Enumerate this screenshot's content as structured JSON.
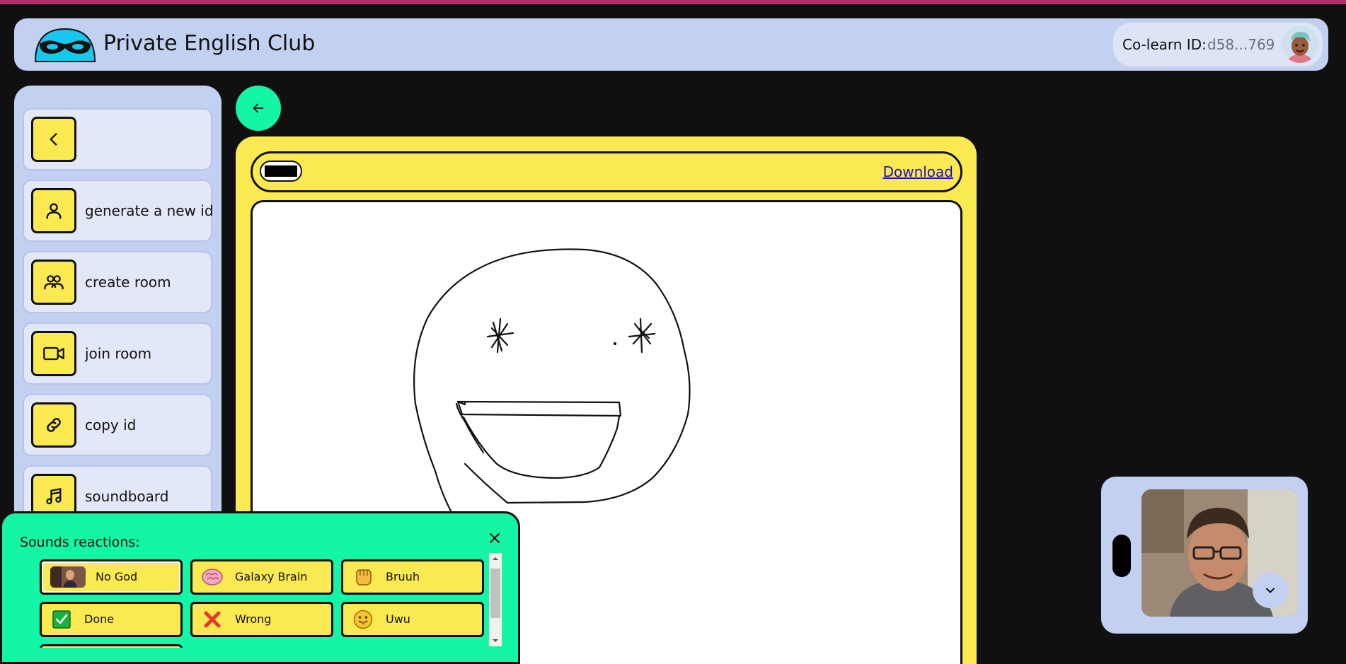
{
  "header": {
    "app_title": "Private English Club",
    "colearn_label": "Co-learn ID:",
    "colearn_id": "d58...769"
  },
  "sidebar": {
    "items": [
      {
        "label": "",
        "icon": "chevron-left-icon"
      },
      {
        "label": "generate a new id",
        "icon": "user-icon"
      },
      {
        "label": "create room",
        "icon": "users-icon"
      },
      {
        "label": "join room",
        "icon": "video-camera-icon"
      },
      {
        "label": "copy id",
        "icon": "link-icon"
      },
      {
        "label": "soundboard",
        "icon": "music-note-icon"
      }
    ]
  },
  "board": {
    "download_label": "Download",
    "pen_color": "#000000"
  },
  "sounds": {
    "title": "Sounds reactions:",
    "buttons": [
      {
        "label": "No God",
        "icon": "photo-thumbnail"
      },
      {
        "label": "Galaxy Brain",
        "icon": "brain-icon"
      },
      {
        "label": "Bruuh",
        "icon": "fist-icon"
      },
      {
        "label": "Done",
        "icon": "check-icon"
      },
      {
        "label": "Wrong",
        "icon": "cross-icon"
      },
      {
        "label": "Uwu",
        "icon": "tongue-face-icon"
      }
    ]
  },
  "colors": {
    "accent": "#14f5a6",
    "yellow": "#fbe951",
    "panel": "#c2d0f2",
    "link": "#1a0dcc"
  }
}
